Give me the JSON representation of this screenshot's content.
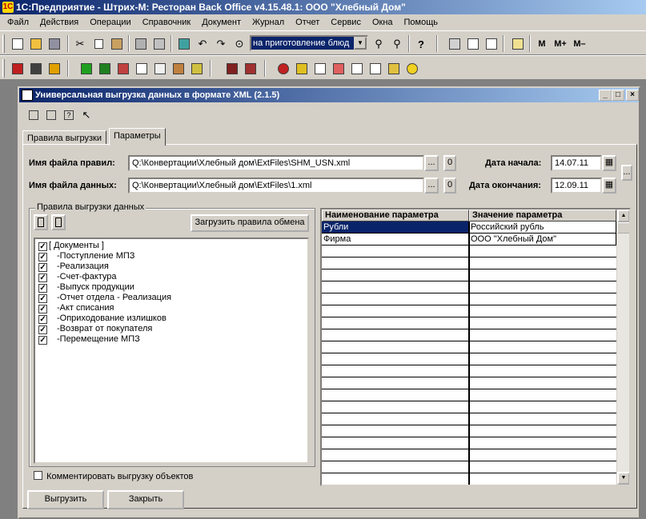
{
  "app": {
    "title": "1С:Предприятие - Штрих-М: Ресторан Back Office v4.15.48.1: ООО \"Хлебный Дом\"",
    "logo": "1С"
  },
  "menu": [
    "Файл",
    "Действия",
    "Операции",
    "Справочник",
    "Документ",
    "Журнал",
    "Отчет",
    "Сервис",
    "Окна",
    "Помощь"
  ],
  "toolbar": {
    "combo_value": "на приготовление блюд",
    "m_label": "М",
    "m_plus_label": "М+",
    "m_minus_label": "М–"
  },
  "window": {
    "title": "Универсальная выгрузка данных в формате XML (2.1.5)",
    "tabs": [
      "Правила выгрузки",
      "Параметры"
    ],
    "rules_file_label": "Имя файла правил:",
    "rules_file_value": "Q:\\Конвертации\\Хлебный дом\\ExtFiles\\SHM_USN.xml",
    "data_file_label": "Имя файла данных:",
    "data_file_value": "Q:\\Конвертации\\Хлебный дом\\ExtFiles\\1.xml",
    "browse_label": "...",
    "clear_label": "0",
    "start_date_label": "Дата начала:",
    "start_date_value": "14.07.11",
    "end_date_label": "Дата окончания:",
    "end_date_value": "12.09.11",
    "rules_group_label": "Правила выгрузки данных",
    "load_rules_button": "Загрузить правила обмена",
    "tree_items": [
      "[ Документы ]",
      "-Поступление МПЗ",
      "-Реализация",
      "-Счет-фактура",
      "-Выпуск продукции",
      "-Отчет отдела - Реализация",
      "-Акт списания",
      "-Оприходование излишков",
      "-Возврат от покупателя",
      "-Перемещение МПЗ"
    ],
    "comment_checkbox_label": "Комментировать выгрузку объектов",
    "export_button": "Выгрузить",
    "close_button": "Закрыть",
    "grid": {
      "columns": [
        "Наименование параметра",
        "Значение параметра"
      ],
      "rows": [
        [
          "Рубли",
          "Российский рубль"
        ],
        [
          "Фирма",
          "ООО \"Хлебный Дом\""
        ]
      ]
    }
  }
}
